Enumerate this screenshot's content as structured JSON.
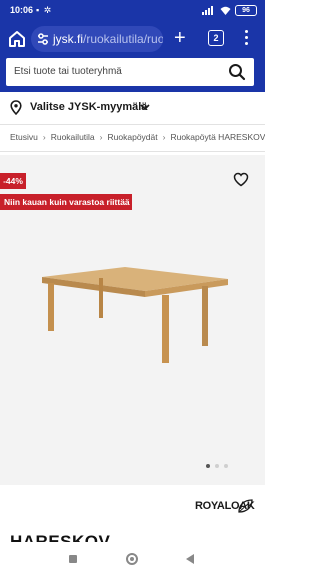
{
  "status_bar": {
    "time": "10:06",
    "left_icons": "▪ ✲",
    "battery": "96"
  },
  "browser": {
    "url_domain": "jysk.fi",
    "url_path": "/ruokailutila/ruo",
    "tab_count": "2"
  },
  "search": {
    "placeholder": "Etsi tuote tai tuoteryhmä"
  },
  "store": {
    "label": "Valitse JYSK-myymälä"
  },
  "breadcrumb": [
    "Etusivu",
    "Ruokailutila",
    "Ruokapöydät",
    "Ruokapöytä HARESKOV"
  ],
  "product": {
    "discount_badge": "-44%",
    "stock_badge": "Niin kauan kuin varastoa riittää",
    "brand": "ROYALOAK",
    "title": "HARESKOV",
    "gallery_total": 3,
    "gallery_active": 1
  },
  "colors": {
    "brand_blue": "#1a35a8",
    "badge_red": "#c8202a"
  },
  "icons": {
    "home": "home-icon",
    "site_settings": "tune-icon",
    "new_tab": "plus-icon",
    "menu": "more-vertical-icon",
    "search": "search-icon",
    "location": "map-pin-icon",
    "favorite": "heart-icon"
  }
}
